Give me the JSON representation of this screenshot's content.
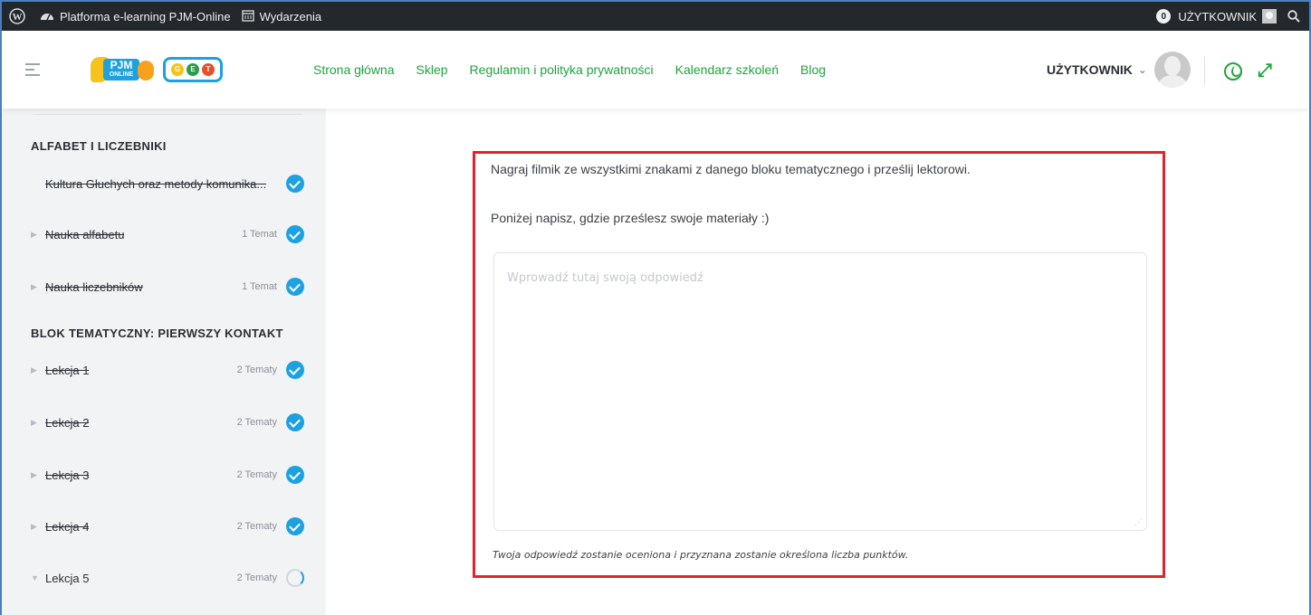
{
  "admin_bar": {
    "site_name": "Platforma e-learning PJM-Online",
    "events": "Wydarzenia",
    "notifications_count": "0",
    "user": "UŻYTKOWNIK"
  },
  "header": {
    "logo_pjm": "PJM",
    "logo_pjm_sub": "ONLINE",
    "logo_get": [
      "G",
      "E",
      "T"
    ],
    "nav": [
      "Strona główna",
      "Sklep",
      "Regulamin i polityka prywatności",
      "Kalendarz szkoleń",
      "Blog"
    ],
    "user_name": "UŻYTKOWNIK",
    "chevron": "⌄",
    "expand": "⤢"
  },
  "sidebar": {
    "section1": "ALFABET I LICZEBNIKI",
    "section2": "BLOK TEMATYCZNY: PIERWSZY KONTAKT",
    "items": [
      {
        "label": "Kultura Głuchych oraz metody komunika...",
        "count": "",
        "status": "done"
      },
      {
        "label": "Nauka alfabetu",
        "count": "1 Temat",
        "status": "done"
      },
      {
        "label": "Nauka liczebników",
        "count": "1 Temat",
        "status": "done"
      },
      {
        "label": "Lekcja 1",
        "count": "2 Tematy",
        "status": "done"
      },
      {
        "label": "Lekcja 2",
        "count": "2 Tematy",
        "status": "done"
      },
      {
        "label": "Lekcja 3",
        "count": "2 Tematy",
        "status": "done"
      },
      {
        "label": "Lekcja 4",
        "count": "2 Tematy",
        "status": "done"
      },
      {
        "label": "Lekcja 5",
        "count": "2 Tematy",
        "status": "in-progress"
      }
    ]
  },
  "main": {
    "question_line1": "Nagraj filmik ze wszystkimi znakami z danego bloku tematycznego i prześlij lektorowi.",
    "question_line2": "Poniżej napisz, gdzie prześlesz swoje materiały :)",
    "answer_placeholder": "Wprowadź tutaj swoją odpowiedź",
    "answer_value": "",
    "hint": "Twoja odpowiedź zostanie oceniona i przyznana zostanie określona liczba punktów."
  },
  "colors": {
    "accent_green": "#1ea33c",
    "check_blue": "#1da1e0",
    "highlight_red": "#e3232c",
    "admin_bar": "#23282d"
  }
}
